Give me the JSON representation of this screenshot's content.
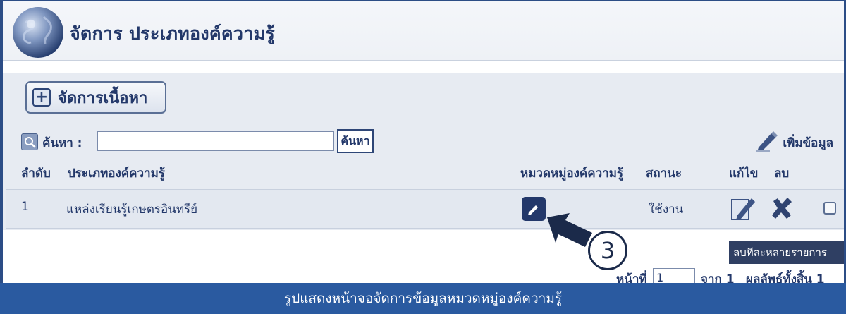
{
  "header": {
    "title": "จัดการ ประเภทองค์ความรู้",
    "logo_icon": "globe-icon"
  },
  "toolbar": {
    "content_button_label": "จัดการเนื้อหา",
    "content_button_icon": "plus-icon"
  },
  "search": {
    "label": "ค้นหา :",
    "value": "",
    "button_label": "ค้นหา",
    "icon": "magnifier-icon"
  },
  "actions": {
    "add_label": "เพิ่มข้อมูล",
    "add_icon": "pencil-icon"
  },
  "table": {
    "headers": {
      "order": "ลำดับ",
      "type": "ประเภทองค์ความรู้",
      "category": "หมวดหมู่องค์ความรู้",
      "status": "สถานะ",
      "edit": "แก้ไข",
      "delete": "ลบ"
    },
    "rows": [
      {
        "order": "1",
        "type": "แหล่งเรียนรู้เกษตรอินทรีย์",
        "status": "ใช้งาน",
        "checked": false
      }
    ]
  },
  "callout": {
    "step_number": "3"
  },
  "bulk_delete_label": "ลบทีละหลายรายการ",
  "pager": {
    "page_label": "หน้าที่",
    "page_value": "1",
    "of_label": "จาก 1",
    "total_label": "ผลลัพธ์ทั้งสิ้น 1"
  },
  "caption": "รูปแสดงหน้าจอจัดการข้อมูลหมวดหมู่องค์ความรู้",
  "colors": {
    "accent": "#23386a",
    "caption_bg": "#2a5aa0",
    "row_bg": "#e3e8f0",
    "band_bg": "#e7ebf2"
  }
}
